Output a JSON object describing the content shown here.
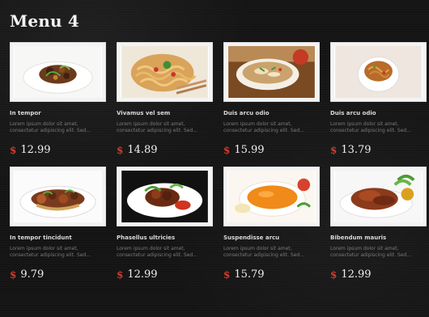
{
  "page_title": "Menu 4",
  "items": [
    {
      "name": "In tempor",
      "desc": "Lorem ipsum dolor sit amet, consectetur adipiscing elit. Sed...",
      "currency": "$",
      "price": "12.99",
      "image": "stir-fry-plate"
    },
    {
      "name": "Vivamus vel sem",
      "desc": "Lorem ipsum dolor sit amet, consectetur adipiscing elit. Sed...",
      "currency": "$",
      "price": "14.89",
      "image": "noodles-with-chopsticks"
    },
    {
      "name": "Duis arcu odio",
      "desc": "Lorem ipsum dolor sit amet, consectetur adipiscing elit. Sed...",
      "currency": "$",
      "price": "15.99",
      "image": "soup-bowl"
    },
    {
      "name": "Duis arcu odio",
      "desc": "Lorem ipsum dolor sit amet, consectetur adipiscing elit. Sed...",
      "currency": "$",
      "price": "13.79",
      "image": "pasta-bowl"
    },
    {
      "name": "In tempor tincidunt",
      "desc": "Lorem ipsum dolor sit amet, consectetur adipiscing elit. Sed...",
      "currency": "$",
      "price": "9.79",
      "image": "mixed-grill-plate"
    },
    {
      "name": "Phasellus ultricies",
      "desc": "Lorem ipsum dolor sit amet, consectetur adipiscing elit. Sed...",
      "currency": "$",
      "price": "12.99",
      "image": "chicken-with-sauce"
    },
    {
      "name": "Suspendisse arcu",
      "desc": "Lorem ipsum dolor sit amet, consectetur adipiscing elit. Sed...",
      "currency": "$",
      "price": "15.79",
      "image": "pumpkin-soup"
    },
    {
      "name": "Bibendum mauris",
      "desc": "Lorem ipsum dolor sit amet, consectetur adipiscing elit. Sed...",
      "currency": "$",
      "price": "12.99",
      "image": "roast-duck"
    }
  ],
  "colors": {
    "background": "#141414",
    "accent": "#d23b2c"
  }
}
